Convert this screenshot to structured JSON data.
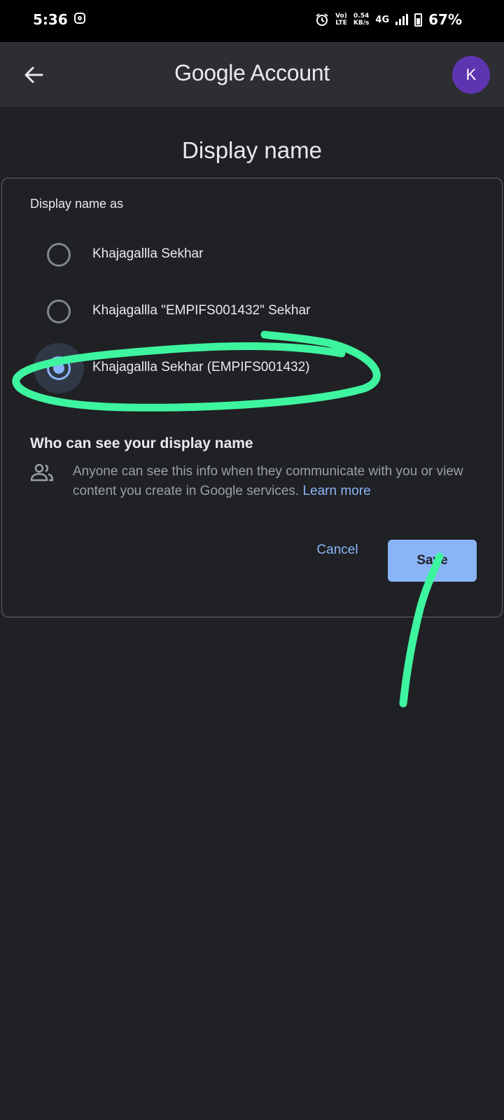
{
  "status_bar": {
    "time": "5:36",
    "volte_top": "Vo)",
    "volte_bottom": "LTE",
    "speed_value": "0.54",
    "speed_unit": "KB/s",
    "network": "4G",
    "battery": "67%"
  },
  "app_bar": {
    "title": "Google Account",
    "avatar_letter": "K",
    "avatar_color": "#5e35b1"
  },
  "page": {
    "title": "Display name"
  },
  "card": {
    "section_label": "Display name as",
    "options": [
      {
        "label": "Khajagallla Sekhar",
        "selected": false
      },
      {
        "label": "Khajagallla \"EMPIFS001432\" Sekhar",
        "selected": false
      },
      {
        "label": "Khajagallla Sekhar (EMPIFS001432)",
        "selected": true
      }
    ],
    "who_heading": "Who can see your display name",
    "info_text": "Anyone can see this info when they communicate with you or view content you create in Google services.",
    "learn_more": "Learn more",
    "cancel_label": "Cancel",
    "save_label": "Save"
  },
  "colors": {
    "background": "#202124",
    "accent": "#8ab4f8",
    "annotation": "#3ef59f"
  }
}
